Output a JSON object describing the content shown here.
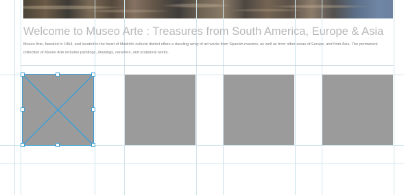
{
  "page": {
    "title": "Welcome to Museo Arte : Treasures from South America, Europe & Asia",
    "intro": "Museo Arte, founded in 1864, and located in the heart of Madrid's cultural district offers a dazzling array of art works from Spanish masters, as well as from other areas of Europe, and from Asia. The permanent collection at Museo Arte includes paintings, drawings, ceramics, and sculptural works."
  },
  "placeholder": {
    "icon": "image-placeholder-icon",
    "fill_color": "#9b9b9b",
    "selection_color": "#3aa0d8",
    "tile_count": 4
  },
  "colors": {
    "guide": "#cfe4ec",
    "title_text": "#b9b9b9",
    "body_text": "#7c7c7c"
  }
}
